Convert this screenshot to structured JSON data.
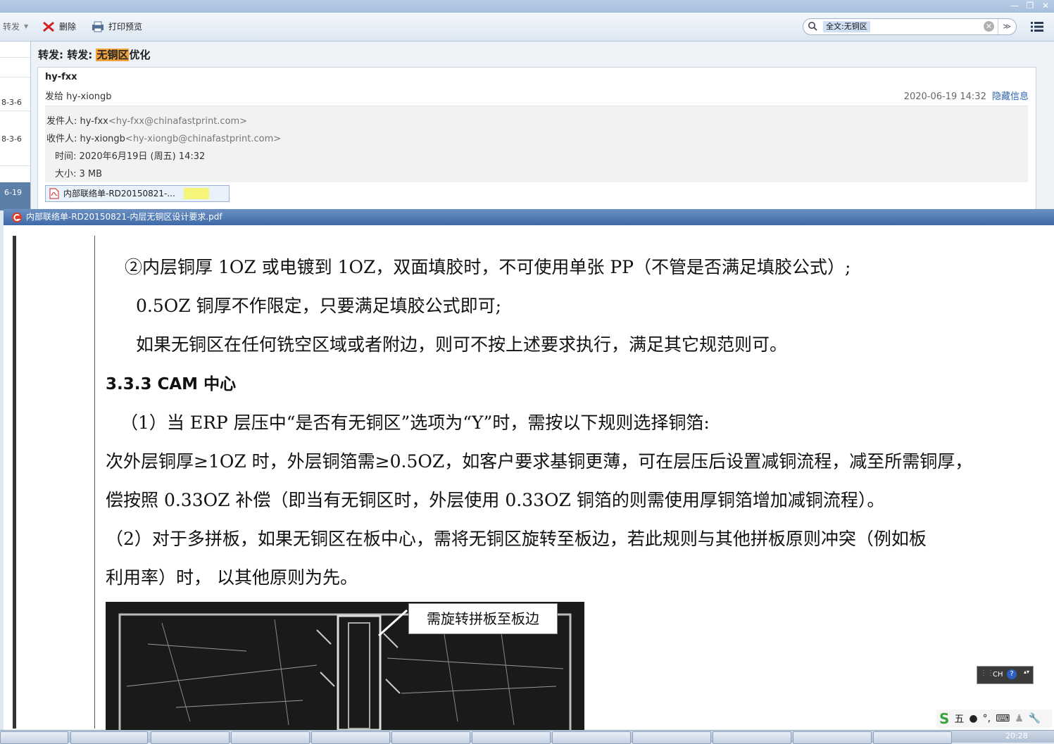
{
  "toolbar": {
    "forward_label": "转发",
    "delete_label": "删除",
    "print_preview_label": "打印预览",
    "search_value": "全文:无铜区"
  },
  "left_list": {
    "items": [
      "8-3-6",
      "8-3-6",
      "6-19"
    ]
  },
  "mail": {
    "subject_prefix": "转发: 转发: ",
    "subject_highlight": "无铜区",
    "subject_suffix": "优化",
    "sender": "hy-fxx",
    "sent_to": "发给 hy-xiongb",
    "date": "2020-06-19 14:32",
    "hide_info": "隐藏信息",
    "from_label": "发件人: hy-fxx",
    "from_email": "<hy-fxx@chinafastprint.com>",
    "to_label": "收件人: hy-xiongb",
    "to_email": "<hy-xiongb@chinafastprint.com>",
    "time_label": "时间: 2020年6月19日 (周五) 14:32",
    "size_label": "大小: 3 MB",
    "attachment": "内部联络单-RD20150821-..."
  },
  "pdf": {
    "title": "内部联络单-RD20150821-内层无铜区设计要求.pdf",
    "lines": [
      "②内层铜厚 1OZ 或电镀到 1OZ，双面填胶时，不可使用单张 PP（不管是否满足填胶公式）;",
      "0.5OZ 铜厚不作限定，只要满足填胶公式即可;",
      "如果无铜区在任何铣空区域或者附边，则可不按上述要求执行，满足其它规范则可。",
      "3.3.3 CAM 中心",
      "（1）当 ERP 层压中“是否有无铜区”选项为“Y”时，需按以下规则选择铜箔:",
      "次外层铜厚≥1OZ 时，外层铜箔需≥0.5OZ，如客户要求基铜更薄，可在层压后设置减铜流程，减至所需铜厚，",
      "偿按照 0.33OZ 补偿（即当有无铜区时，外层使用 0.33OZ 铜箔的则需使用厚铜箔增加减铜流程）。",
      "（2）对于多拼板，如果无铜区在板中心，需将无铜区旋转至板边，若此规则与其他拼板原则冲突（例如板",
      "利用率）时，  以其他原则为先。"
    ],
    "callout": "需旋转拼板至板边"
  },
  "ime": {
    "lang": "CH",
    "wubi": "五"
  },
  "taskbar": {
    "clock": "20:28"
  },
  "colors": {
    "highlight": "#f2a23c",
    "link": "#2d63b3",
    "pdf_title_bar": "#4a74ad"
  }
}
